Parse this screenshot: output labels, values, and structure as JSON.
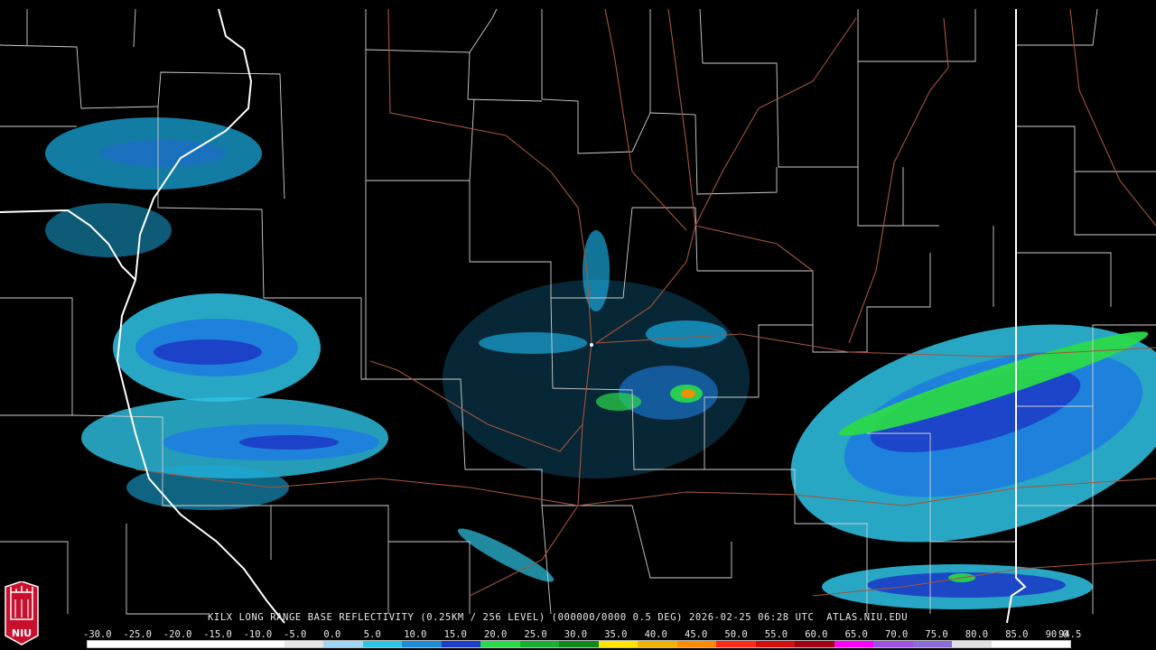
{
  "caption": "KILX LONG RANGE BASE REFLECTIVITY (0.25KM / 256 LEVEL) (000000/0000 0.5 DEG) 2026-02-25 06:28 UTC  ATLAS.NIU.EDU",
  "logo_text": "NIU",
  "scale_labels": [
    "-30.0",
    "-25.0",
    "-20.0",
    "-15.0",
    "-10.0",
    "-5.0",
    "0.0",
    "5.0",
    "10.0",
    "15.0",
    "20.0",
    "25.0",
    "30.0",
    "35.0",
    "40.0",
    "45.0",
    "50.0",
    "55.0",
    "60.0",
    "65.0",
    "70.0",
    "75.0",
    "80.0",
    "85.0",
    "90.0",
    "94.5"
  ],
  "scale_colors": [
    "#ffffff",
    "#ffffff",
    "#ffffff",
    "#ffffff",
    "#ffffff",
    "#e6e6e6",
    "#9fd6f4",
    "#2ec4e6",
    "#1a8cd8",
    "#1e3ec8",
    "#2bd94a",
    "#18b030",
    "#0e8a20",
    "#ffe600",
    "#f0b400",
    "#ff8c00",
    "#ff2b1a",
    "#d31010",
    "#a00010",
    "#ff00ff",
    "#a050e0",
    "#8c6cd8",
    "#e0e0e0",
    "#ffffff",
    "#ffffff"
  ],
  "colors": {
    "state_border": "#ffffff",
    "county_border": "#cfcfcf",
    "highway": "#a5543a"
  }
}
